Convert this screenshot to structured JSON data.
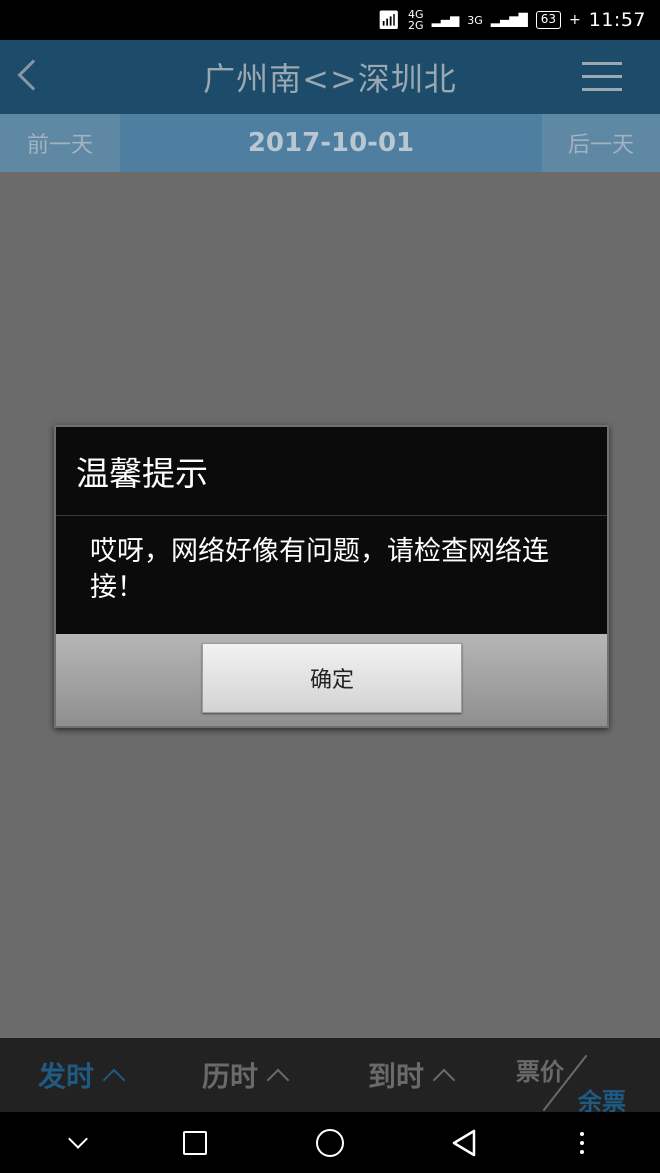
{
  "status_bar": {
    "network_4g": "4G",
    "network_2g": "2G",
    "network_3g": "3G",
    "battery": "63",
    "time": "11:57"
  },
  "header": {
    "title": "广州南<>深圳北"
  },
  "date_bar": {
    "prev_day": "前一天",
    "current_date": "2017-10-01",
    "next_day": "后一天"
  },
  "sort_bar": {
    "depart_time": "发时",
    "duration": "历时",
    "arrive_time": "到时",
    "price": "票价",
    "remaining": "余票"
  },
  "dialog": {
    "title": "温馨提示",
    "message": "哎呀，网络好像有问题，请检查网络连接！",
    "confirm_label": "确定"
  },
  "colors": {
    "active_sort": "#1f5a82",
    "title_bar": "#1d4c6b",
    "date_bar": "#4f7fa0"
  }
}
